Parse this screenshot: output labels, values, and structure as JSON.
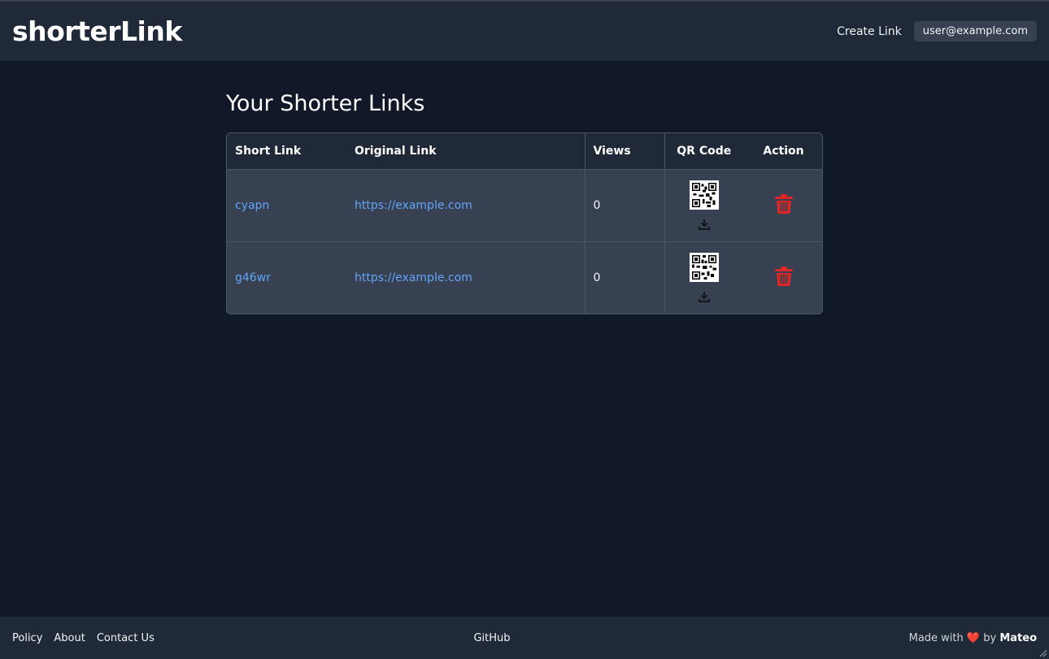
{
  "header": {
    "brand": "shorterLink",
    "create_link_label": "Create Link",
    "user_email": "user@example.com"
  },
  "main": {
    "title": "Your Shorter Links",
    "columns": [
      "Short Link",
      "Original Link",
      "Views",
      "QR Code",
      "Action"
    ],
    "rows": [
      {
        "short": "cyapn",
        "original": "https://example.com",
        "views": "0"
      },
      {
        "short": "g46wr",
        "original": "https://example.com",
        "views": "0"
      }
    ]
  },
  "footer": {
    "links": [
      "Policy",
      "About",
      "Contact Us"
    ],
    "github": "GitHub",
    "made_with": "Made with",
    "heart": "❤️",
    "by": "by",
    "author": "Mateo"
  },
  "colors": {
    "page_bg": "#111827",
    "bar_bg": "#1f2937",
    "row_bg": "#374151",
    "link": "#60a5fa",
    "danger": "#dc2626"
  },
  "icons": [
    "qr-code-icon",
    "download-icon",
    "trash-icon",
    "heart-icon"
  ]
}
